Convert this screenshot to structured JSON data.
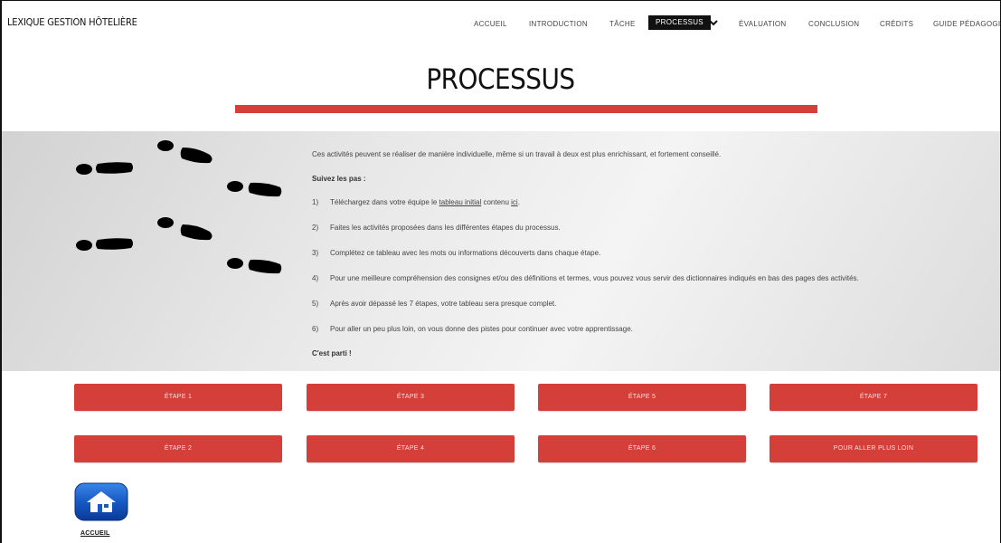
{
  "site_title": "LEXIQUE GESTION HÔTELIÈRE",
  "nav": [
    {
      "label": "ACCUEIL",
      "active": false
    },
    {
      "label": "INTRODUCTION",
      "active": false
    },
    {
      "label": "TÂCHE",
      "active": false
    },
    {
      "label": "PROCESSUS",
      "active": true
    },
    {
      "label": "ÉVALUATION",
      "active": false
    },
    {
      "label": "CONCLUSION",
      "active": false
    },
    {
      "label": "CRÉDITS",
      "active": false
    },
    {
      "label": "GUIDE PÉDAGOGIQU",
      "active": false
    }
  ],
  "page_title": "PROCESSUS",
  "content": {
    "intro": "Ces activités peuvent se réaliser de manière individuelle, même si un travail à deux est plus enrichissant, et fortement conseillé.",
    "subheading": "Suivez les pas :",
    "step1": {
      "num": "1)",
      "before": "Téléchargez dans votre équipe le ",
      "link1": "tableau initial",
      "middle": " contenu ",
      "link2": "ici",
      "after": "."
    },
    "steps": [
      {
        "num": "2)",
        "text": "Faites les activités proposées dans les différentes étapes du processus."
      },
      {
        "num": "3)",
        "text": "Complétez ce tableau avec les mots ou informations découverts dans chaque étape."
      },
      {
        "num": "4)",
        "text": "Pour une meilleure compréhension des consignes et/ou des définitions et termes, vous  pouvez vous servir des dictionnaires indiqués en bas des pages des activités."
      },
      {
        "num": "5)",
        "text": "Après avoir dépassé les 7 étapes, votre tableau sera presque complet."
      },
      {
        "num": "6)",
        "text": "Pour aller un peu plus loin, on vous donne des pistes pour continuer avec votre apprentissage."
      }
    ],
    "final": "C'est parti !"
  },
  "buttons": {
    "etape1": "ÉTAPE 1",
    "etape2": "ÉTAPE 2",
    "etape3": "ÉTAPE 3",
    "etape4": "ÉTAPE 4",
    "etape5": "ÉTAPE 5",
    "etape6": "ÉTAPE 6",
    "etape7": "ÉTAPE 7",
    "plus_loin": "POUR ALLER PLUS LOIN"
  },
  "home_label": "ACCUEIL",
  "colors": {
    "accent": "#d43f3a",
    "home_icon": "#1659c4",
    "nav_active_bg": "#111111"
  },
  "icons": [
    "chevron-down-icon",
    "footprints-icon",
    "home-icon"
  ]
}
